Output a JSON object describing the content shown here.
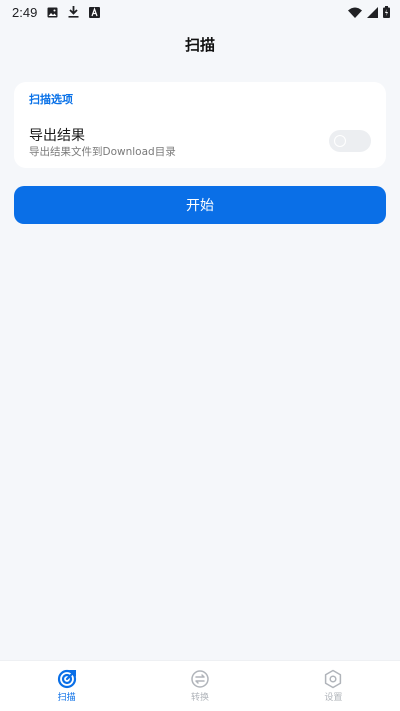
{
  "status_bar": {
    "time": "2:49",
    "icons": [
      "image-notification-icon",
      "download-icon",
      "accessibility-a-icon",
      "wifi-icon",
      "signal-icon",
      "battery-icon"
    ]
  },
  "header": {
    "title": "扫描"
  },
  "options_card": {
    "section_label": "扫描选项",
    "export_option": {
      "title": "导出结果",
      "description": "导出结果文件到Download目录",
      "enabled": false
    }
  },
  "start_button": {
    "label": "开始"
  },
  "bottom_nav": {
    "items": [
      {
        "label": "扫描",
        "icon": "scan-icon",
        "active": true
      },
      {
        "label": "转换",
        "icon": "convert-icon",
        "active": false
      },
      {
        "label": "设置",
        "icon": "settings-icon",
        "active": false
      }
    ]
  },
  "colors": {
    "accent": "#0a6fe7",
    "background": "#f5f7fa",
    "card": "#ffffff",
    "inactive": "#b0b4ba"
  }
}
